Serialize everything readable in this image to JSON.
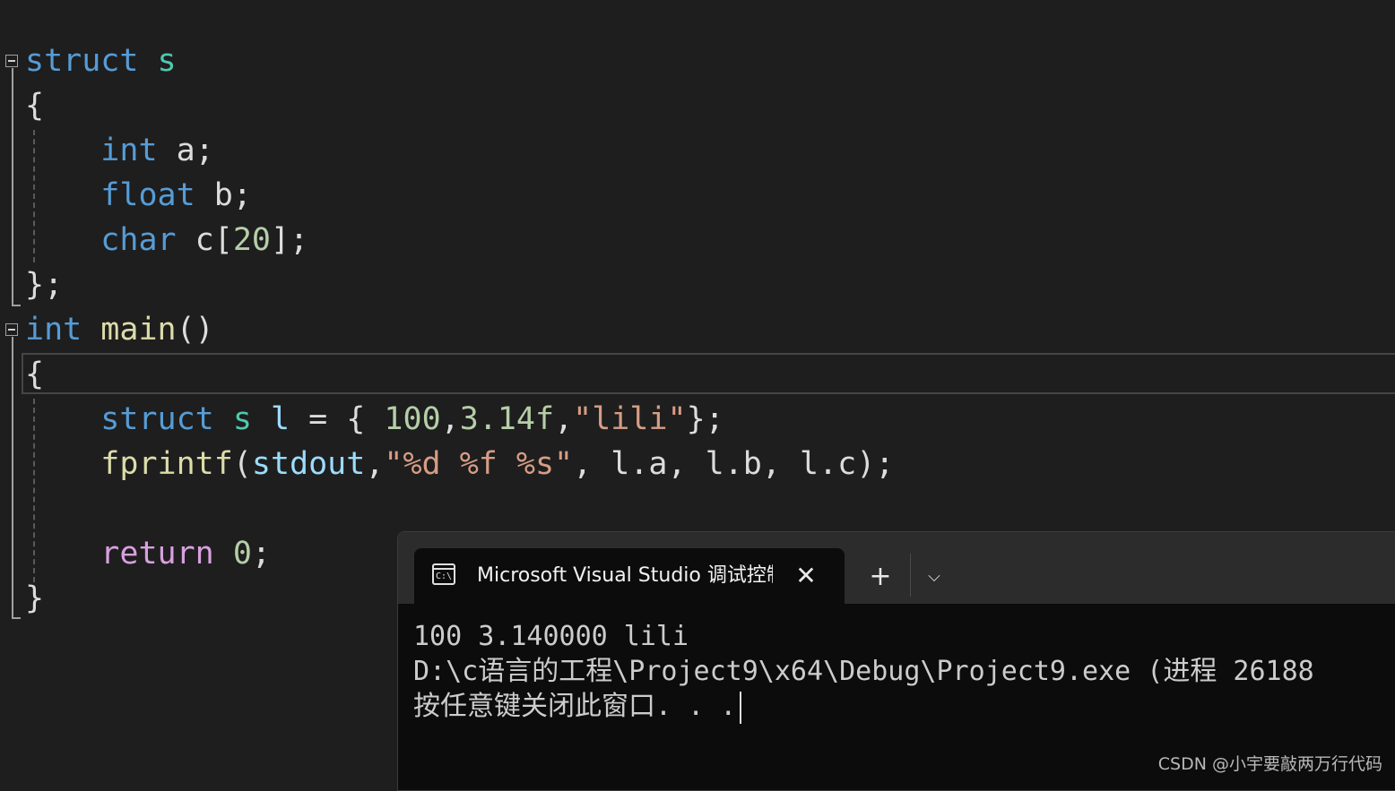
{
  "editor": {
    "code": {
      "line1": {
        "kw": "struct",
        "name": "s"
      },
      "line2": {
        "brace": "{"
      },
      "line3": {
        "kw": "int",
        "rest": "a;"
      },
      "line4": {
        "kw": "float",
        "rest": "b;"
      },
      "line5": {
        "kw": "char",
        "var": "c",
        "open": "[",
        "num": "20",
        "close": "];"
      },
      "line6": {
        "brace": "};"
      },
      "line7": {
        "kw": "int",
        "fn": "main",
        "parens": "()"
      },
      "line8": {
        "brace": "{"
      },
      "line9": {
        "kw": "struct",
        "type": "s",
        "var": "l",
        "eq": "= {",
        "n1": "100",
        "c1": ",",
        "n2": "3.14f",
        "c2": ",",
        "str": "\"lili\"",
        "end": "};"
      },
      "line10": {
        "fn": "fprintf",
        "open": "(",
        "var": "stdout",
        "comma": ",",
        "str": "\"%d %f %s\"",
        "args": ", l.a, l.b, l.c);"
      },
      "line12": {
        "kw": "return",
        "num": "0",
        "end": ";"
      },
      "line13": {
        "brace": "}"
      }
    }
  },
  "terminal": {
    "tab_title": "Microsoft Visual Studio 调试控制台",
    "tab_icon_text": "C:\\",
    "close_glyph": "✕",
    "new_tab_glyph": "+",
    "dropdown_glyph": "⌵",
    "output": [
      "100 3.140000 lili",
      "D:\\c语言的工程\\Project9\\x64\\Debug\\Project9.exe (进程 26188",
      "按任意键关闭此窗口. . ."
    ]
  },
  "watermark": "CSDN @小宇要敲两万行代码"
}
